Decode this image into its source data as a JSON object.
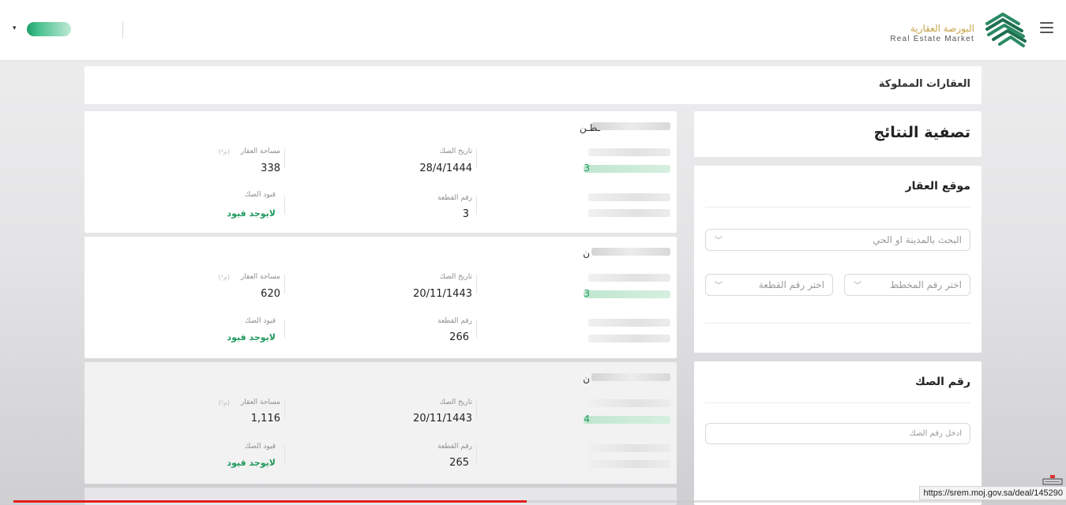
{
  "header": {
    "logo_ar": "البورصة العقارية",
    "logo_en": "Real Estate Market",
    "menu_icon": "hamburger-icon",
    "user_caret": "▾",
    "colors": {
      "brand_green": "#1e9e6a",
      "brand_gold": "#c9a34a"
    }
  },
  "page": {
    "title": "العقارات المملوكة"
  },
  "filter": {
    "title": "تصفية النتائج",
    "location": {
      "title": "موقع العقار",
      "city_placeholder": "البحث بالمدينة او الحي",
      "plan_placeholder": "اختر رقم المخطط",
      "parcel_placeholder": "اختر رقم القطعة"
    },
    "deed": {
      "title": "رقم الصك",
      "deed_placeholder": "ادخل رقم الصك"
    }
  },
  "labels": {
    "deed_date": "تاريخ الصك",
    "area": "مساحة العقار",
    "parcel_no": "رقم القطعة",
    "deed_restrictions": "قيود الصك",
    "unit": "(م²)"
  },
  "cards": [
    {
      "name": "ـطـن",
      "id_prefix": "3",
      "deed_date": "28/4/1444",
      "area": "338",
      "parcel_no": "3",
      "restrictions": "لايوجد قيود"
    },
    {
      "name": "ن",
      "id_prefix": "3",
      "deed_date": "20/11/1443",
      "area": "620",
      "parcel_no": "266",
      "restrictions": "لايوجد قيود"
    },
    {
      "name": "ن",
      "id_prefix": "4",
      "deed_date": "20/11/1443",
      "area": "1,116",
      "parcel_no": "265",
      "restrictions": "لايوجد قيود"
    }
  ],
  "status_url": "https://srem.moj.gov.sa/deal/145290"
}
